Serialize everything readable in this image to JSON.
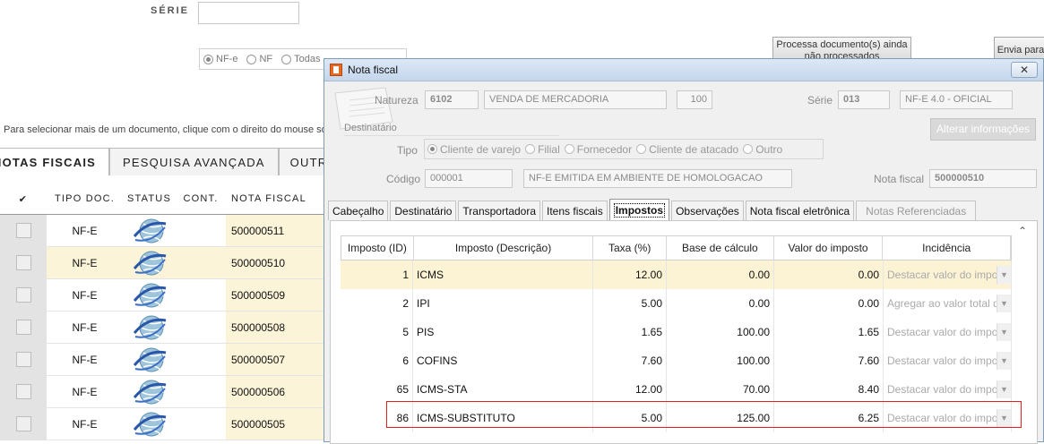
{
  "background": {
    "serie_label": "SÉRIE",
    "radio_options": [
      {
        "label": "NF-e",
        "checked": true
      },
      {
        "label": "NF",
        "checked": false
      },
      {
        "label": "Todas",
        "checked": false
      }
    ],
    "process_button": "Processa documento(s) ainda não processados",
    "send_button": "Envia para",
    "hint": "Para selecionar mais de um documento, clique com o direito do mouse sobre",
    "tabs": [
      "NOTAS FISCAIS",
      "PESQUISA AVANÇADA",
      "OUTR"
    ],
    "table_headers": [
      "✔",
      "TIPO DOC.",
      "STATUS",
      "CONT.",
      "NOTA FISCAL"
    ],
    "rows": [
      {
        "tipo": "NF-E",
        "nota": "500000511"
      },
      {
        "tipo": "NF-E",
        "nota": "500000510"
      },
      {
        "tipo": "NF-E",
        "nota": "500000509"
      },
      {
        "tipo": "NF-E",
        "nota": "500000508"
      },
      {
        "tipo": "NF-E",
        "nota": "500000507"
      },
      {
        "tipo": "NF-E",
        "nota": "500000506"
      },
      {
        "tipo": "NF-E",
        "nota": "500000505"
      }
    ]
  },
  "dialog": {
    "title": "Nota fiscal",
    "close": "✕",
    "natureza_label": "Natureza",
    "natureza_code": "6102",
    "natureza_desc": "VENDA DE MERCADORIA",
    "natureza_num": "100",
    "serie_label": "Série",
    "serie_value": "013",
    "serie_desc": "NF-E 4.0 - OFICIAL",
    "destinatario_label": "Destinatário",
    "alterar_button": "Alterar informações",
    "tipo_label": "Tipo",
    "tipo_options": [
      "Cliente de varejo",
      "Filial",
      "Fornecedor",
      "Cliente de atacado",
      "Outro"
    ],
    "codigo_label": "Código",
    "codigo_value": "000001",
    "codigo_desc": "NF-E EMITIDA EM AMBIENTE DE HOMOLOGACAO",
    "nota_label": "Nota fiscal",
    "nota_value": "500000510",
    "tabs": [
      "Cabeçalho",
      "Destinatário",
      "Transportadora",
      "Itens fiscais",
      "Impostos",
      "Observações",
      "Nota fiscal eletrônica",
      "Notas Referenciadas"
    ],
    "grid_headers": [
      "Imposto (ID)",
      "Imposto (Descrição)",
      "Taxa (%)",
      "Base de cálculo",
      "Valor do imposto",
      "Incidência"
    ],
    "grid_rows": [
      {
        "id": "1",
        "desc": "ICMS",
        "taxa": "12.00",
        "base": "0.00",
        "valor": "0.00",
        "inc": "Destacar valor do imposto"
      },
      {
        "id": "2",
        "desc": "IPI",
        "taxa": "5.00",
        "base": "0.00",
        "valor": "0.00",
        "inc": "Agregar ao valor total da"
      },
      {
        "id": "5",
        "desc": "PIS",
        "taxa": "1.65",
        "base": "100.00",
        "valor": "1.65",
        "inc": "Destacar valor do imposto"
      },
      {
        "id": "6",
        "desc": "COFINS",
        "taxa": "7.60",
        "base": "100.00",
        "valor": "7.60",
        "inc": "Destacar valor do imposto"
      },
      {
        "id": "65",
        "desc": "ICMS-STA",
        "taxa": "12.00",
        "base": "70.00",
        "valor": "8.40",
        "inc": "Destacar valor do imposto"
      },
      {
        "id": "86",
        "desc": "ICMS-SUBSTITUTO",
        "taxa": "5.00",
        "base": "125.00",
        "valor": "6.25",
        "inc": "Destacar valor do imposto"
      }
    ]
  }
}
